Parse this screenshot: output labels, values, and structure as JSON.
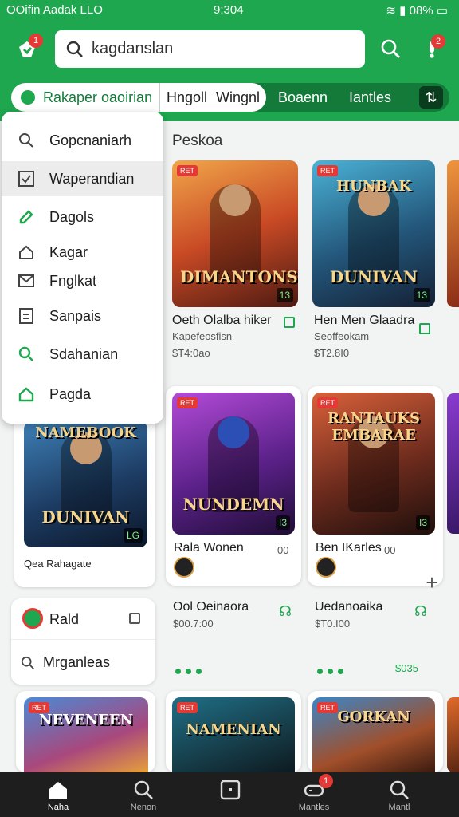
{
  "status_bar": {
    "left": "OOifin Aadak LLO",
    "time": "9:304",
    "right": "08%"
  },
  "header": {
    "notif_count": "1",
    "alert_count": "2",
    "search": {
      "value": "kagdanslan",
      "placeholder": "kagdanslan"
    }
  },
  "chips": [
    "Rakaper oaoirian",
    "Hngoll",
    "Wingnl",
    "Boaenn",
    "Iantles"
  ],
  "dropdown": {
    "items": [
      {
        "label": "Gopcnaniarh",
        "icon": "search-icon"
      },
      {
        "label": "Waperandian",
        "icon": "checkbox-icon",
        "selected": true
      },
      {
        "label": "Dagols",
        "icon": "pencil-icon"
      },
      {
        "label": "Kagar",
        "icon": "home-icon"
      },
      {
        "label": "Fnglkat",
        "icon": "mail-icon"
      },
      {
        "label": "Sanpais",
        "icon": "document-icon"
      },
      {
        "label": "Sdahanian",
        "icon": "search-icon"
      },
      {
        "label": "Pagda",
        "icon": "home-icon"
      }
    ]
  },
  "section_title": "Peskoa",
  "games": [
    {
      "tag": "RET",
      "rating": "13",
      "art_title": "DIMANTONS",
      "title": "Oeth Olalba hiker",
      "subtitle": "Kapefeosfisn",
      "price": "$T4:0ao"
    },
    {
      "tag": "RET",
      "rating": "13",
      "art_title_top": "HUNBAK",
      "art_title": "DUNIVAN",
      "title": "Hen Men Glaadra",
      "subtitle": "Seoffeokam",
      "price": "$T2.8I0"
    },
    {
      "tag": "RET",
      "rating": "I3",
      "art_title": "NUNDEMN",
      "title": "Rala Wonen",
      "meta": "00"
    },
    {
      "tag": "RET",
      "rating": "I3",
      "art_title_top": "RANTAUKS EMBARAE",
      "title": "Ben IKarles",
      "meta": "00"
    },
    {
      "tag": "RET",
      "rating": "LG",
      "art_title_top": "NAMEBOOK",
      "art_title": "DUNIVAN",
      "title": "Qea Rahagate"
    }
  ],
  "row_texts": [
    {
      "title": "Ool Oeinaora",
      "price": "$00.7:00"
    },
    {
      "title": "Uedanoaika",
      "price": "$T0.I00"
    }
  ],
  "price_right": "$035",
  "left_panel": {
    "item1": "Rald",
    "item2": "Mrganleas"
  },
  "bottom_row": [
    {
      "tag": "RET",
      "art_title": "NEVENEEN"
    },
    {
      "tag": "RET",
      "art_title": "NAMENIAN"
    },
    {
      "tag": "RET",
      "art_title": "GORKAN"
    }
  ],
  "bottom_nav": [
    {
      "label": "Naha",
      "icon": "home-icon",
      "active": true
    },
    {
      "label": "Nenon",
      "icon": "search-icon"
    },
    {
      "label": "",
      "icon": "square-icon"
    },
    {
      "label": "Mantles",
      "icon": "gamepad-icon",
      "badge": "1"
    },
    {
      "label": "Mantl",
      "icon": "search-icon"
    }
  ],
  "colors": {
    "brand": "#1fa74f",
    "brand_dark": "#137a3a",
    "badge": "#e53935",
    "nav_bg": "#1e1e1e"
  }
}
